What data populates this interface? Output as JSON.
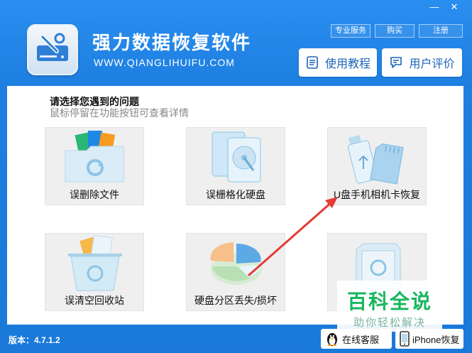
{
  "titlebar": {
    "minimize_glyph": "—",
    "close_glyph": "✕"
  },
  "app": {
    "title": "强力数据恢复软件",
    "url": "WWW.QIANGLIHUIFU.COM",
    "logo_icon": "drive-tools-icon"
  },
  "top_links": [
    "专业服务",
    "购买",
    "注册"
  ],
  "header_buttons": [
    {
      "label": "使用教程",
      "icon": "document-icon"
    },
    {
      "label": "用户评价",
      "icon": "comment-icon"
    }
  ],
  "prompt": {
    "title": "请选择您遇到的问题",
    "subtitle": "鼠标停留在功能按钮可查看详情"
  },
  "tiles": [
    {
      "label": "误删除文件",
      "icon": "folder-restore-icon"
    },
    {
      "label": "误栅格化硬盘",
      "icon": "hard-disk-icon"
    },
    {
      "label": "U盘手机相机卡恢复",
      "icon": "usb-sdcard-icon"
    },
    {
      "label": "误清空回收站",
      "icon": "recycle-bin-icon"
    },
    {
      "label": "硬盘分区丢失/损坏",
      "icon": "partition-pie-icon"
    },
    {
      "label": "",
      "icon": "safe-restore-icon"
    }
  ],
  "watermark": {
    "title": "百科全说",
    "subtitle": "助你轻松解决"
  },
  "footer": {
    "version": "版本：4.7.1.2",
    "buttons": [
      {
        "label": "在线客服",
        "icon": "penguin-icon"
      },
      {
        "label": "iPhone恢复",
        "icon": "phone-icon"
      }
    ]
  },
  "colors": {
    "window_blue": "#1e7fe0",
    "tile_bg": "#efefef",
    "arrow_red": "#e63a33",
    "watermark_green": "#17b65f"
  }
}
